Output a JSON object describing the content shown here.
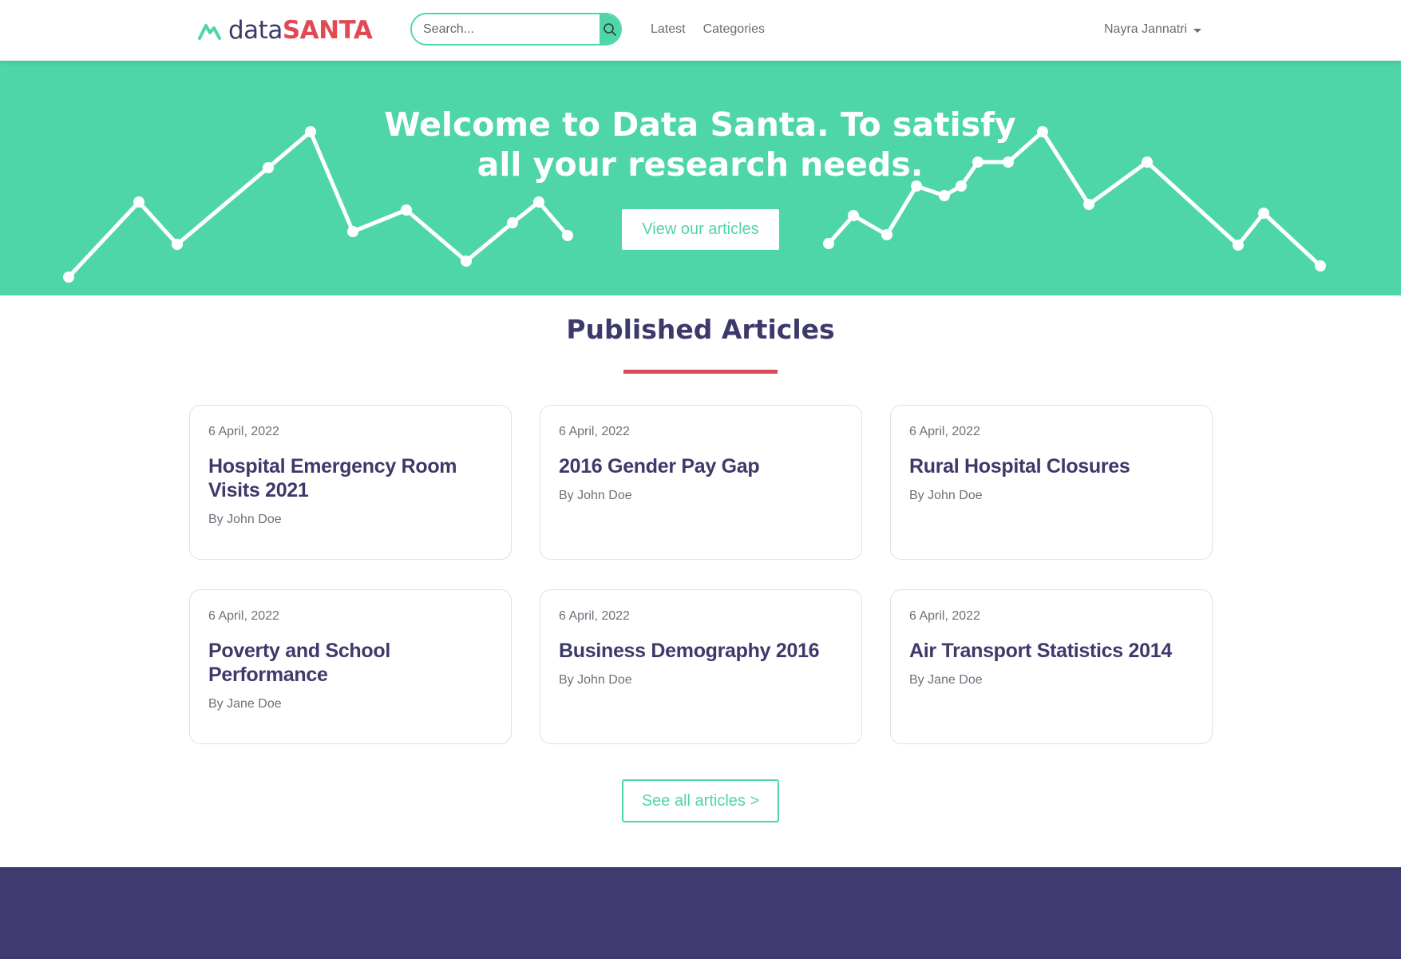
{
  "navbar": {
    "logo": {
      "prefix": "data",
      "suffix": "SANTA"
    },
    "search": {
      "placeholder": "Search..."
    },
    "links": [
      "Latest",
      "Categories"
    ],
    "user": "Nayra Jannatri"
  },
  "hero": {
    "title": "Welcome to Data Santa. To satisfy all your research needs.",
    "button": "View our articles"
  },
  "section": {
    "title": "Published Articles"
  },
  "articles": [
    {
      "date": "6 April, 2022",
      "title": "Hospital Emergency Room Visits 2021",
      "author": "By John Doe"
    },
    {
      "date": "6 April, 2022",
      "title": "2016 Gender Pay Gap",
      "author": "By John Doe"
    },
    {
      "date": "6 April, 2022",
      "title": "Rural Hospital Closures",
      "author": "By John Doe"
    },
    {
      "date": "6 April, 2022",
      "title": "Poverty and School Performance",
      "author": "By Jane Doe"
    },
    {
      "date": "6 April, 2022",
      "title": "Business Demography 2016",
      "author": "By John Doe"
    },
    {
      "date": "6 April, 2022",
      "title": "Air Transport Statistics 2014",
      "author": "By Jane Doe"
    }
  ],
  "see_all": "See all articles >",
  "colors": {
    "primary": "#4ed6a9",
    "brand_red": "#e04a55",
    "navy": "#3d3a6b",
    "footer": "#3f3a70",
    "underline": "#d44d57"
  },
  "icons": {
    "logo": "line-chart-logo-icon",
    "search": "search-icon",
    "user_dropdown": "caret-down-icon",
    "hero": "line-chart-decoration-icon"
  }
}
